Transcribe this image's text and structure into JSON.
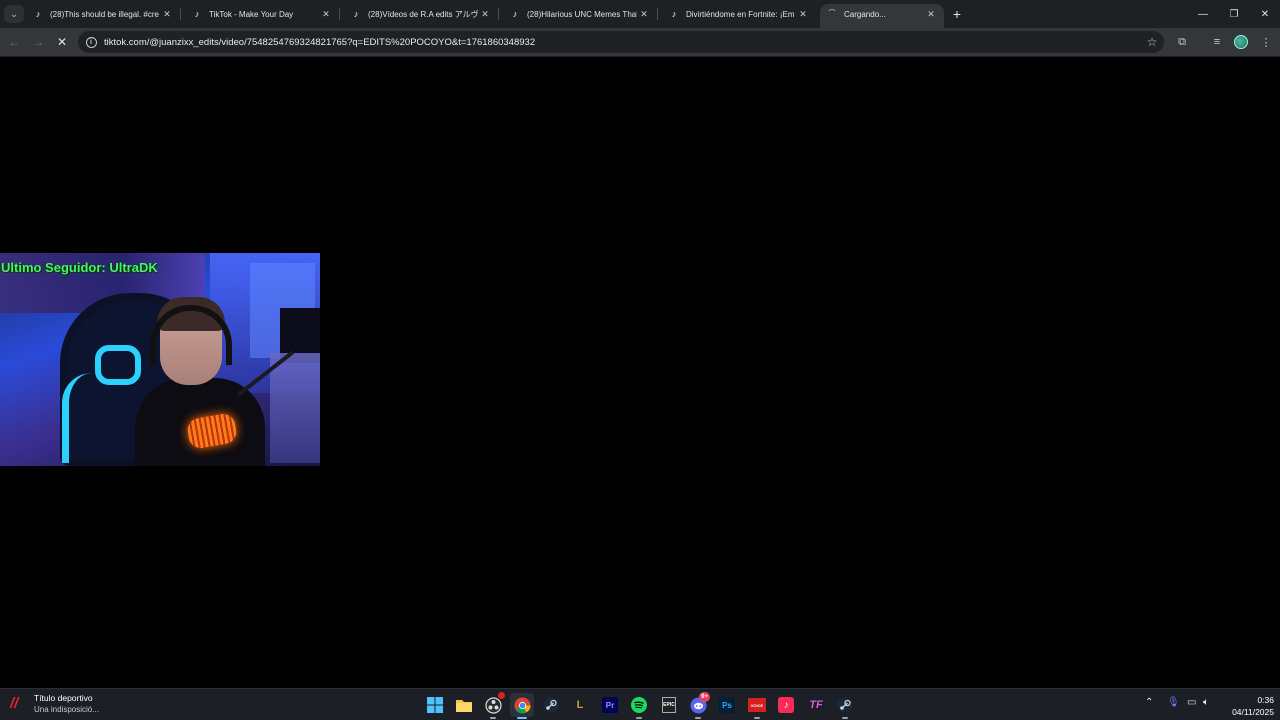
{
  "browser": {
    "tabs": [
      {
        "label": "(28)This should be illegal. #cre",
        "favicon": "tiktok-icon"
      },
      {
        "label": "TikTok - Make Your Day",
        "favicon": "tiktok-icon"
      },
      {
        "label": "(28)Vídeos de R.A edits アルヴァ",
        "favicon": "tiktok-icon"
      },
      {
        "label": "(28)Hilarious UNC Memes That",
        "favicon": "tiktok-icon"
      },
      {
        "label": "Divirtiéndome en Fortnite: ¡Em",
        "favicon": "tiktok-icon"
      },
      {
        "label": "Cargando...",
        "favicon": "loading-spinner",
        "active": true
      }
    ],
    "address": "tiktok.com/@juanzixx_edits/video/7548254769324821765?q=EDITS%20POCOYO&t=1761860348932"
  },
  "content": {
    "overlay_text": "Ultimo Seguidor: UltraDK"
  },
  "taskbar": {
    "news_title": "Título deportivo",
    "news_subtitle": "Una indisposició...",
    "apps": [
      "windows-start",
      "file-explorer",
      "obs-studio",
      "chrome",
      "steam",
      "league-of-legends",
      "premiere-pro",
      "spotify",
      "epic-games",
      "discord",
      "photoshop",
      "voicemeeter",
      "tiktok",
      "tf",
      "steam-2"
    ],
    "badges": {
      "discord": "9+"
    },
    "time": "0:36",
    "date": "04/11/2025"
  },
  "colors": {
    "overlay": "#4cf06a",
    "accent": "#6ec1ff",
    "tab_bg": "#1f2023",
    "toolbar_bg": "#35363a"
  }
}
